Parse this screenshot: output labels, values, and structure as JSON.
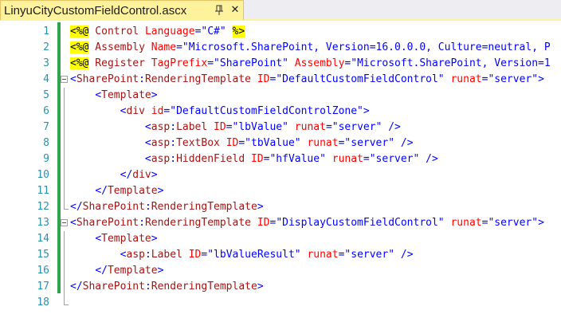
{
  "tab": {
    "title": "LinyuCityCustomFieldControl.ascx",
    "pin_icon": "pin-icon",
    "close_icon": "close-icon"
  },
  "colors": {
    "tab_active": "#fff29d",
    "line_number": "#2b91af",
    "change_bar": "#2ea44f",
    "directive_highlight": "#ffff00"
  },
  "editor": {
    "line_numbers": [
      "1",
      "2",
      "3",
      "4",
      "5",
      "6",
      "7",
      "8",
      "9",
      "10",
      "11",
      "12",
      "13",
      "14",
      "15",
      "16",
      "17",
      "18"
    ],
    "lines": [
      {
        "parts": [
          {
            "t": "<%@",
            "c": "pre"
          },
          {
            "t": " Control ",
            "c": "el"
          },
          {
            "t": "Language",
            "c": "at"
          },
          {
            "t": "=",
            "c": "br"
          },
          {
            "t": "\"C#\"",
            "c": "av"
          },
          {
            "t": " ",
            "c": "tx"
          },
          {
            "t": "%>",
            "c": "pre"
          }
        ]
      },
      {
        "parts": [
          {
            "t": "<%@",
            "c": "pre"
          },
          {
            "t": " Assembly ",
            "c": "el"
          },
          {
            "t": "Name",
            "c": "at"
          },
          {
            "t": "=",
            "c": "br"
          },
          {
            "t": "\"Microsoft.SharePoint, Version=16.0.0.0, Culture=neutral, P",
            "c": "av"
          }
        ]
      },
      {
        "parts": [
          {
            "t": "<%@",
            "c": "pre"
          },
          {
            "t": " Register ",
            "c": "el"
          },
          {
            "t": "TagPrefix",
            "c": "at"
          },
          {
            "t": "=",
            "c": "br"
          },
          {
            "t": "\"SharePoint\"",
            "c": "av"
          },
          {
            "t": " ",
            "c": "tx"
          },
          {
            "t": "Assembly",
            "c": "at"
          },
          {
            "t": "=",
            "c": "br"
          },
          {
            "t": "\"Microsoft.SharePoint, Version=1",
            "c": "av"
          }
        ]
      },
      {
        "parts": [
          {
            "t": "<",
            "c": "br"
          },
          {
            "t": "SharePoint",
            "c": "el"
          },
          {
            "t": ":",
            "c": "br"
          },
          {
            "t": "RenderingTemplate",
            "c": "el"
          },
          {
            "t": " ",
            "c": "tx"
          },
          {
            "t": "ID",
            "c": "at"
          },
          {
            "t": "=",
            "c": "br"
          },
          {
            "t": "\"DefaultCustomFieldControl\"",
            "c": "av"
          },
          {
            "t": " ",
            "c": "tx"
          },
          {
            "t": "runat",
            "c": "at"
          },
          {
            "t": "=",
            "c": "br"
          },
          {
            "t": "\"server\"",
            "c": "av"
          },
          {
            "t": ">",
            "c": "br"
          }
        ]
      },
      {
        "parts": [
          {
            "t": "    ",
            "c": "tx"
          },
          {
            "t": "<",
            "c": "br"
          },
          {
            "t": "Template",
            "c": "el"
          },
          {
            "t": ">",
            "c": "br"
          }
        ]
      },
      {
        "parts": [
          {
            "t": "        ",
            "c": "tx"
          },
          {
            "t": "<",
            "c": "br"
          },
          {
            "t": "div",
            "c": "el"
          },
          {
            "t": " ",
            "c": "tx"
          },
          {
            "t": "id",
            "c": "at"
          },
          {
            "t": "=",
            "c": "br"
          },
          {
            "t": "\"DefaultCustomFieldControlZone\"",
            "c": "av"
          },
          {
            "t": ">",
            "c": "br"
          }
        ]
      },
      {
        "parts": [
          {
            "t": "            ",
            "c": "tx"
          },
          {
            "t": "<",
            "c": "br"
          },
          {
            "t": "asp",
            "c": "el"
          },
          {
            "t": ":",
            "c": "br"
          },
          {
            "t": "Label",
            "c": "el"
          },
          {
            "t": " ",
            "c": "tx"
          },
          {
            "t": "ID",
            "c": "at"
          },
          {
            "t": "=",
            "c": "br"
          },
          {
            "t": "\"lbValue\"",
            "c": "av"
          },
          {
            "t": " ",
            "c": "tx"
          },
          {
            "t": "runat",
            "c": "at"
          },
          {
            "t": "=",
            "c": "br"
          },
          {
            "t": "\"server\"",
            "c": "av"
          },
          {
            "t": " />",
            "c": "br"
          }
        ]
      },
      {
        "parts": [
          {
            "t": "            ",
            "c": "tx"
          },
          {
            "t": "<",
            "c": "br"
          },
          {
            "t": "asp",
            "c": "el"
          },
          {
            "t": ":",
            "c": "br"
          },
          {
            "t": "TextBox",
            "c": "el"
          },
          {
            "t": " ",
            "c": "tx"
          },
          {
            "t": "ID",
            "c": "at"
          },
          {
            "t": "=",
            "c": "br"
          },
          {
            "t": "\"tbValue\"",
            "c": "av"
          },
          {
            "t": " ",
            "c": "tx"
          },
          {
            "t": "runat",
            "c": "at"
          },
          {
            "t": "=",
            "c": "br"
          },
          {
            "t": "\"server\"",
            "c": "av"
          },
          {
            "t": " />",
            "c": "br"
          }
        ]
      },
      {
        "parts": [
          {
            "t": "            ",
            "c": "tx"
          },
          {
            "t": "<",
            "c": "br"
          },
          {
            "t": "asp",
            "c": "el"
          },
          {
            "t": ":",
            "c": "br"
          },
          {
            "t": "HiddenField",
            "c": "el"
          },
          {
            "t": " ",
            "c": "tx"
          },
          {
            "t": "ID",
            "c": "at"
          },
          {
            "t": "=",
            "c": "br"
          },
          {
            "t": "\"hfValue\"",
            "c": "av"
          },
          {
            "t": " ",
            "c": "tx"
          },
          {
            "t": "runat",
            "c": "at"
          },
          {
            "t": "=",
            "c": "br"
          },
          {
            "t": "\"server\"",
            "c": "av"
          },
          {
            "t": " />",
            "c": "br"
          }
        ]
      },
      {
        "parts": [
          {
            "t": "        ",
            "c": "tx"
          },
          {
            "t": "</",
            "c": "br"
          },
          {
            "t": "div",
            "c": "el"
          },
          {
            "t": ">",
            "c": "br"
          }
        ]
      },
      {
        "parts": [
          {
            "t": "    ",
            "c": "tx"
          },
          {
            "t": "</",
            "c": "br"
          },
          {
            "t": "Template",
            "c": "el"
          },
          {
            "t": ">",
            "c": "br"
          }
        ]
      },
      {
        "parts": [
          {
            "t": "</",
            "c": "br"
          },
          {
            "t": "SharePoint",
            "c": "el"
          },
          {
            "t": ":",
            "c": "br"
          },
          {
            "t": "RenderingTemplate",
            "c": "el"
          },
          {
            "t": ">",
            "c": "br"
          }
        ]
      },
      {
        "parts": [
          {
            "t": "<",
            "c": "br"
          },
          {
            "t": "SharePoint",
            "c": "el"
          },
          {
            "t": ":",
            "c": "br"
          },
          {
            "t": "RenderingTemplate",
            "c": "el"
          },
          {
            "t": " ",
            "c": "tx"
          },
          {
            "t": "ID",
            "c": "at"
          },
          {
            "t": "=",
            "c": "br"
          },
          {
            "t": "\"DisplayCustomFieldControl\"",
            "c": "av"
          },
          {
            "t": " ",
            "c": "tx"
          },
          {
            "t": "runat",
            "c": "at"
          },
          {
            "t": "=",
            "c": "br"
          },
          {
            "t": "\"server\"",
            "c": "av"
          },
          {
            "t": ">",
            "c": "br"
          }
        ]
      },
      {
        "parts": [
          {
            "t": "    ",
            "c": "tx"
          },
          {
            "t": "<",
            "c": "br"
          },
          {
            "t": "Template",
            "c": "el"
          },
          {
            "t": ">",
            "c": "br"
          }
        ]
      },
      {
        "parts": [
          {
            "t": "        ",
            "c": "tx"
          },
          {
            "t": "<",
            "c": "br"
          },
          {
            "t": "asp",
            "c": "el"
          },
          {
            "t": ":",
            "c": "br"
          },
          {
            "t": "Label",
            "c": "el"
          },
          {
            "t": " ",
            "c": "tx"
          },
          {
            "t": "ID",
            "c": "at"
          },
          {
            "t": "=",
            "c": "br"
          },
          {
            "t": "\"lbValueResult\"",
            "c": "av"
          },
          {
            "t": " ",
            "c": "tx"
          },
          {
            "t": "runat",
            "c": "at"
          },
          {
            "t": "=",
            "c": "br"
          },
          {
            "t": "\"server\"",
            "c": "av"
          },
          {
            "t": " />",
            "c": "br"
          }
        ]
      },
      {
        "parts": [
          {
            "t": "    ",
            "c": "tx"
          },
          {
            "t": "</",
            "c": "br"
          },
          {
            "t": "Template",
            "c": "el"
          },
          {
            "t": ">",
            "c": "br"
          }
        ]
      },
      {
        "parts": [
          {
            "t": "</",
            "c": "br"
          },
          {
            "t": "SharePoint",
            "c": "el"
          },
          {
            "t": ":",
            "c": "br"
          },
          {
            "t": "RenderingTemplate",
            "c": "el"
          },
          {
            "t": ">",
            "c": "br"
          }
        ]
      },
      {
        "parts": []
      }
    ]
  }
}
